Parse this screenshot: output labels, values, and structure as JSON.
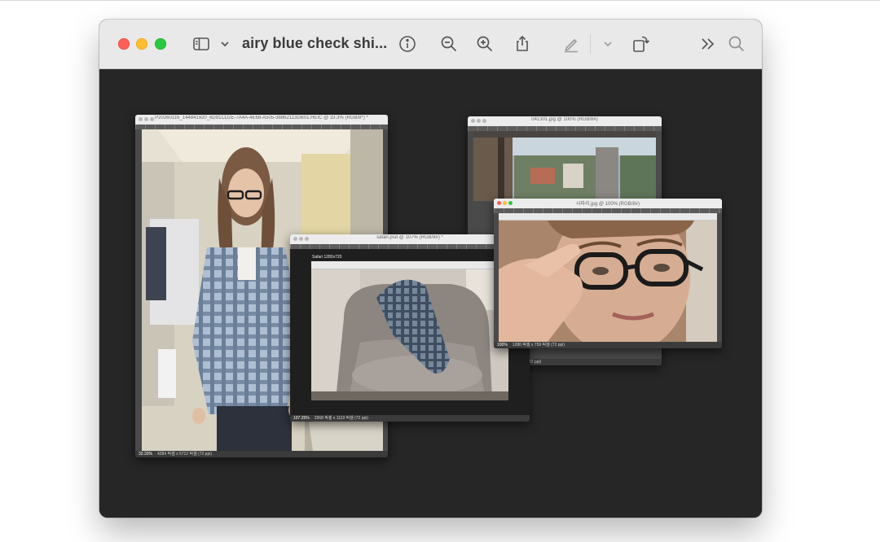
{
  "window": {
    "title": "airy blue check shi...",
    "toolbar_icons": [
      "sidebar-icon",
      "chevron-down-icon",
      "info-icon",
      "zoom-out-icon",
      "zoom-in-icon",
      "share-icon",
      "markup-pen-icon",
      "chevron-down-icon",
      "rotate-icon",
      "more-icon",
      "search-icon"
    ]
  },
  "ps_windows": {
    "w1": {
      "title": "P20260116_144841920_6D91CD2E-7A4A-4E68-A505-38862113DB01.HEIC @ 33.3% (RGB/8*) *",
      "zoom": "33.33%",
      "info": "4284 픽셀 x 5712 픽셀 (72 ppi)"
    },
    "w2": {
      "title": "041301.jpg @ 100% (RGB/8#)",
      "info": "72 ppi)"
    },
    "w3": {
      "title": "safari.psd @ 107% (RGB/8#) *",
      "zoom": "107.25%",
      "info": "2968 픽셀 x 1119 픽셀 (72 ppi)",
      "artboard": "Safari 1280x720"
    },
    "w4": {
      "title": "사파리.jpg @ 100% (RGB/8#)",
      "zoom": "100%",
      "info": "1280 픽셀 x 759 픽셀 (72 ppi)"
    }
  },
  "colors": {
    "toolbar_bg": "#e9e9e9",
    "canvas_bg": "#262626",
    "close": "#fe5f57",
    "minimize": "#febc2e",
    "zoom": "#28c840"
  }
}
